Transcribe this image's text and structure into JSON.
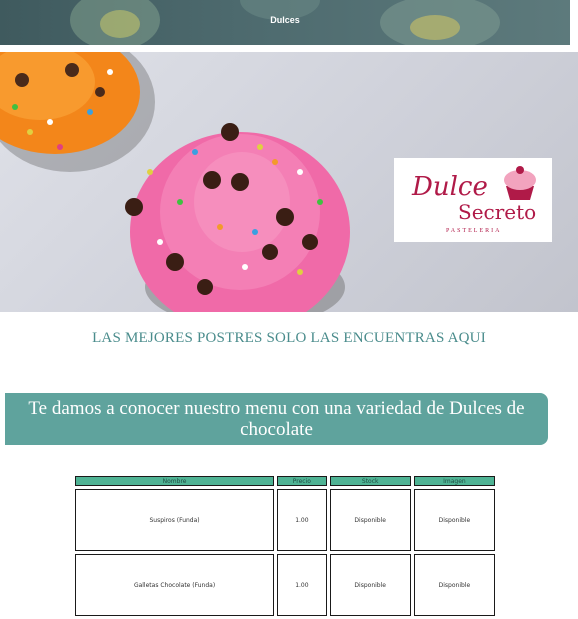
{
  "header": {
    "title": "Dulces"
  },
  "logo": {
    "line1": "Dulce",
    "line2": "Secreto",
    "line3": "PASTELERIA"
  },
  "tagline": "LAS MEJORES POSTRES SOLO LAS ENCUENTRAS AQUI",
  "intro": "Te damos a conocer nuestro menu con una variedad de Dulces de chocolate",
  "table": {
    "headers": [
      "Nombre",
      "Precio",
      "Stock",
      "Imagen"
    ],
    "rows": [
      [
        "Suspiros (Funda)",
        "1.00",
        "Disponible",
        "Disponible"
      ],
      [
        "Galletas Chocolate (Funda)",
        "1.00",
        "Disponible",
        "Disponible"
      ]
    ]
  },
  "colors": {
    "accent": "#5fa39d",
    "table_header": "#4fb394",
    "brand": "#b01a48",
    "tagline": "#4a8c8c"
  }
}
